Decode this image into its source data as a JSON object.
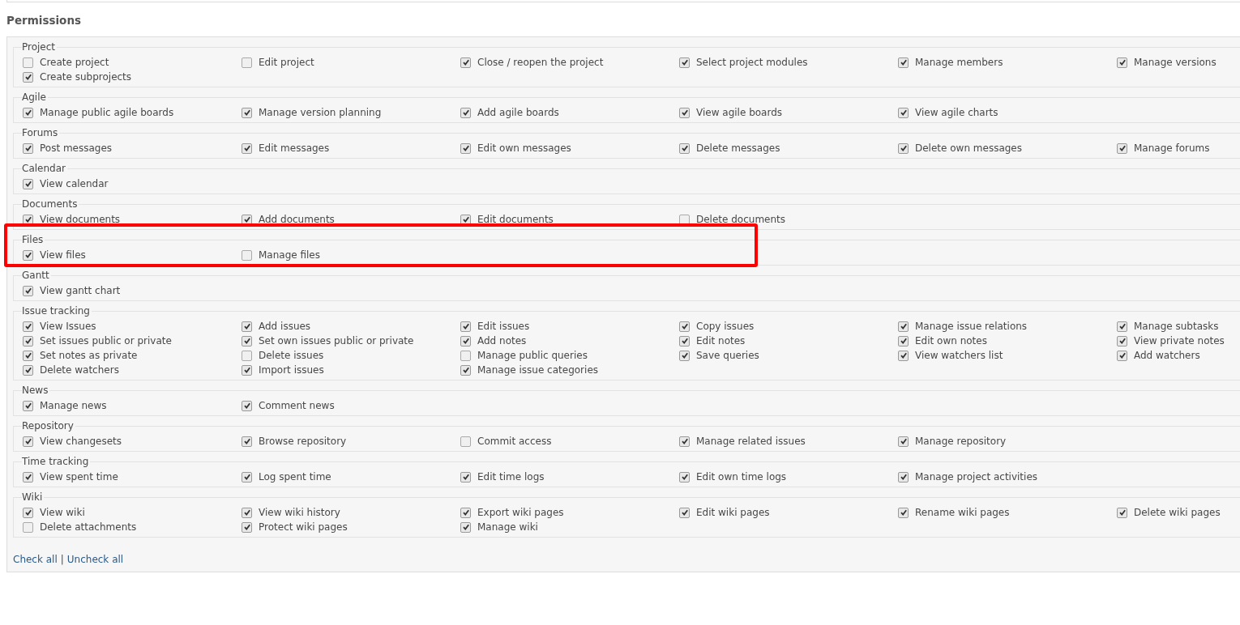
{
  "title": "Permissions",
  "groups": [
    {
      "name": "Project",
      "highlighted": false,
      "items": [
        {
          "label": "Create project",
          "checked": false
        },
        {
          "label": "Edit project",
          "checked": false
        },
        {
          "label": "Close / reopen the project",
          "checked": true
        },
        {
          "label": "Select project modules",
          "checked": true
        },
        {
          "label": "Manage members",
          "checked": true
        },
        {
          "label": "Manage versions",
          "checked": true
        },
        {
          "label": "Create subprojects",
          "checked": true
        }
      ]
    },
    {
      "name": "Agile",
      "highlighted": false,
      "items": [
        {
          "label": "Manage public agile boards",
          "checked": true
        },
        {
          "label": "Manage version planning",
          "checked": true
        },
        {
          "label": "Add agile boards",
          "checked": true
        },
        {
          "label": "View agile boards",
          "checked": true
        },
        {
          "label": "View agile charts",
          "checked": true
        }
      ]
    },
    {
      "name": "Forums",
      "highlighted": false,
      "items": [
        {
          "label": "Post messages",
          "checked": true
        },
        {
          "label": "Edit messages",
          "checked": true
        },
        {
          "label": "Edit own messages",
          "checked": true
        },
        {
          "label": "Delete messages",
          "checked": true
        },
        {
          "label": "Delete own messages",
          "checked": true
        },
        {
          "label": "Manage forums",
          "checked": true
        }
      ]
    },
    {
      "name": "Calendar",
      "highlighted": false,
      "items": [
        {
          "label": "View calendar",
          "checked": true
        }
      ]
    },
    {
      "name": "Documents",
      "highlighted": false,
      "items": [
        {
          "label": "View documents",
          "checked": true
        },
        {
          "label": "Add documents",
          "checked": true
        },
        {
          "label": "Edit documents",
          "checked": true
        },
        {
          "label": "Delete documents",
          "checked": false
        }
      ]
    },
    {
      "name": "Files",
      "highlighted": true,
      "items": [
        {
          "label": "View files",
          "checked": true
        },
        {
          "label": "Manage files",
          "checked": false
        }
      ]
    },
    {
      "name": "Gantt",
      "highlighted": false,
      "items": [
        {
          "label": "View gantt chart",
          "checked": true
        }
      ]
    },
    {
      "name": "Issue tracking",
      "highlighted": false,
      "items": [
        {
          "label": "View Issues",
          "checked": true
        },
        {
          "label": "Add issues",
          "checked": true
        },
        {
          "label": "Edit issues",
          "checked": true
        },
        {
          "label": "Copy issues",
          "checked": true
        },
        {
          "label": "Manage issue relations",
          "checked": true
        },
        {
          "label": "Manage subtasks",
          "checked": true
        },
        {
          "label": "Set issues public or private",
          "checked": true
        },
        {
          "label": "Set own issues public or private",
          "checked": true
        },
        {
          "label": "Add notes",
          "checked": true
        },
        {
          "label": "Edit notes",
          "checked": true
        },
        {
          "label": "Edit own notes",
          "checked": true
        },
        {
          "label": "View private notes",
          "checked": true
        },
        {
          "label": "Set notes as private",
          "checked": true
        },
        {
          "label": "Delete issues",
          "checked": false
        },
        {
          "label": "Manage public queries",
          "checked": false
        },
        {
          "label": "Save queries",
          "checked": true
        },
        {
          "label": "View watchers list",
          "checked": true
        },
        {
          "label": "Add watchers",
          "checked": true
        },
        {
          "label": "Delete watchers",
          "checked": true
        },
        {
          "label": "Import issues",
          "checked": true
        },
        {
          "label": "Manage issue categories",
          "checked": true
        }
      ]
    },
    {
      "name": "News",
      "highlighted": false,
      "items": [
        {
          "label": "Manage news",
          "checked": true
        },
        {
          "label": "Comment news",
          "checked": true
        }
      ]
    },
    {
      "name": "Repository",
      "highlighted": false,
      "items": [
        {
          "label": "View changesets",
          "checked": true
        },
        {
          "label": "Browse repository",
          "checked": true
        },
        {
          "label": "Commit access",
          "checked": false
        },
        {
          "label": "Manage related issues",
          "checked": true
        },
        {
          "label": "Manage repository",
          "checked": true
        }
      ]
    },
    {
      "name": "Time tracking",
      "highlighted": false,
      "items": [
        {
          "label": "View spent time",
          "checked": true
        },
        {
          "label": "Log spent time",
          "checked": true
        },
        {
          "label": "Edit time logs",
          "checked": true
        },
        {
          "label": "Edit own time logs",
          "checked": true
        },
        {
          "label": "Manage project activities",
          "checked": true
        }
      ]
    },
    {
      "name": "Wiki",
      "highlighted": false,
      "items": [
        {
          "label": "View wiki",
          "checked": true
        },
        {
          "label": "View wiki history",
          "checked": true
        },
        {
          "label": "Export wiki pages",
          "checked": true
        },
        {
          "label": "Edit wiki pages",
          "checked": true
        },
        {
          "label": "Rename wiki pages",
          "checked": true
        },
        {
          "label": "Delete wiki pages",
          "checked": true
        },
        {
          "label": "Delete attachments",
          "checked": false
        },
        {
          "label": "Protect wiki pages",
          "checked": true
        },
        {
          "label": "Manage wiki",
          "checked": true
        }
      ]
    }
  ],
  "footer": {
    "check_all": "Check all",
    "separator": "|",
    "uncheck_all": "Uncheck all"
  }
}
